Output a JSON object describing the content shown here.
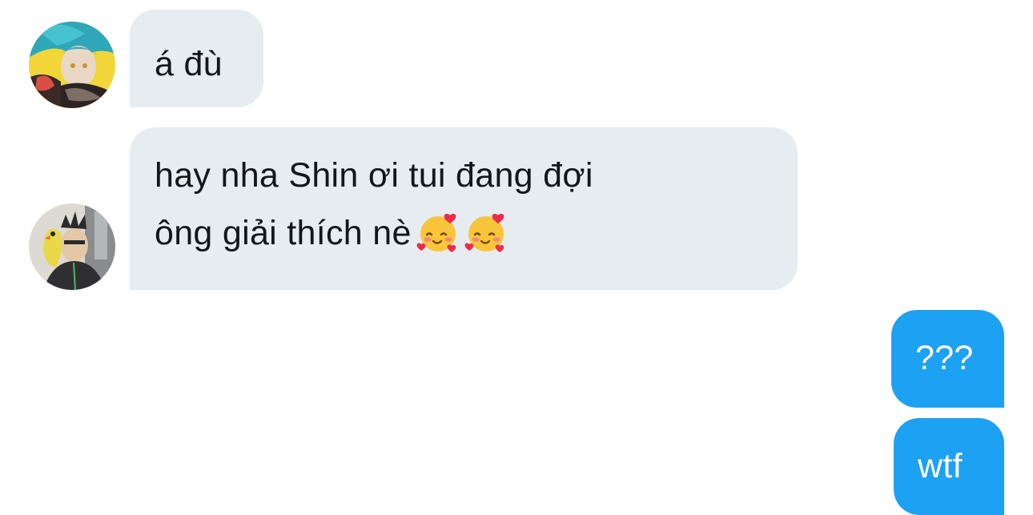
{
  "conversation": {
    "messages": [
      {
        "direction": "incoming",
        "lines": [
          "á đù"
        ]
      },
      {
        "direction": "incoming",
        "lines": [
          "hay nha Shin ơi tui đang đợi",
          "ông giải thích nè"
        ],
        "emoji": [
          "smiling-face-with-hearts",
          "smiling-face-with-hearts"
        ]
      },
      {
        "direction": "outgoing",
        "lines": [
          "???"
        ]
      },
      {
        "direction": "outgoing",
        "lines": [
          "wtf"
        ]
      }
    ]
  },
  "colors": {
    "incoming_bubble": "#e6ecf0",
    "incoming_text": "#14171a",
    "outgoing_bubble": "#1da1f2",
    "outgoing_text": "#ffffff",
    "background": "#ffffff"
  }
}
